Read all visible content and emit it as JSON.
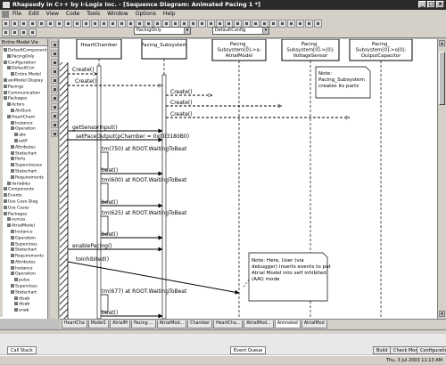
{
  "window": {
    "title": "Rhapsody in C++ by I-Logix Inc. - [Sequence Diagram: Animated Pacing 1 *]",
    "buttons": [
      "_",
      "□",
      "x"
    ]
  },
  "menu": [
    "File",
    "Edit",
    "View",
    "Code",
    "Tools",
    "Window",
    "Options",
    "Help"
  ],
  "toolbar": {
    "config_left": "PacingOnly",
    "config_right": "DefaultConfig"
  },
  "browser": {
    "title": "Entire Model Vie",
    "items": [
      "DefaultComponent",
      "PacingOnly",
      "Configuration",
      "DefaultCon",
      "Entire Model",
      "ainModel Display",
      "Pacings",
      "Communication",
      "Packages",
      "Actors",
      "AtrDunt",
      "HeartCham",
      "Instance",
      "Operation",
      "abc",
      "setP",
      "Attributes",
      "Statechart",
      "Ports",
      "Superclasses",
      "Statechart",
      "Requirements",
      "Variables",
      "Components",
      "Events",
      "Use Case Diag",
      "Use Cases",
      "Packages",
      "ourcas",
      "AtrialModel",
      "Instance",
      "Operation",
      "Superclass",
      "Statechart",
      "Requirements",
      "Attributes",
      "Instance",
      "Operation",
      "pulse",
      "Superclass",
      "Statechart",
      "disab",
      "disab",
      "enab"
    ]
  },
  "lifelines": [
    {
      "label": "HeartChamber"
    },
    {
      "label": "Pacing_Subsystem"
    },
    {
      "label": "Pacing_\nSubsystem[0]->a:\nAtrialModel"
    },
    {
      "label": "Pacing_\nSubsystem[0]->[0]:\nVoltageSensor"
    },
    {
      "label": "Pacing_\nSubsystem[0]->o[0]:\nOutputCapacitor"
    }
  ],
  "messages": [
    "Create()",
    "Create()",
    "Create()",
    "Create()",
    "Create()",
    "getSensorInput()",
    "setPaceOutput(pChamber = 0x003180B0)",
    "tm(750) at ROOT.WaitingToBeat",
    "beat()",
    "tm(600) at ROOT.WaitingToBeat",
    "beat()",
    "tm(625) at ROOT.WaitingToBeat",
    "beat()",
    "enablePacing()",
    "toInhibited()",
    "tm(677) at ROOT.WaitingToBeat",
    "beat()"
  ],
  "notes": [
    "Note:\nPacing_Subsystem\ncreates its parts",
    "Note: Here, User (via\ndebugger) inserts events to put\nAtrial Model into self inhibited\n(AAI) mode"
  ],
  "diagram_tabs": [
    "HeartCha",
    "Model1",
    "AtrialM",
    "Pacing ...",
    "AtrialMod...",
    "Chamber",
    "HeartCha...",
    "AtrialMod...",
    "Animated",
    "AtrialMod"
  ],
  "output_tabs": [
    "Call Stack",
    "Event Queue"
  ],
  "bottom_buttons": [
    "Build",
    "Check Model",
    "Configuration"
  ],
  "status": {
    "datetime": "Thu, 3 Jul 2003  11:13 AM"
  }
}
